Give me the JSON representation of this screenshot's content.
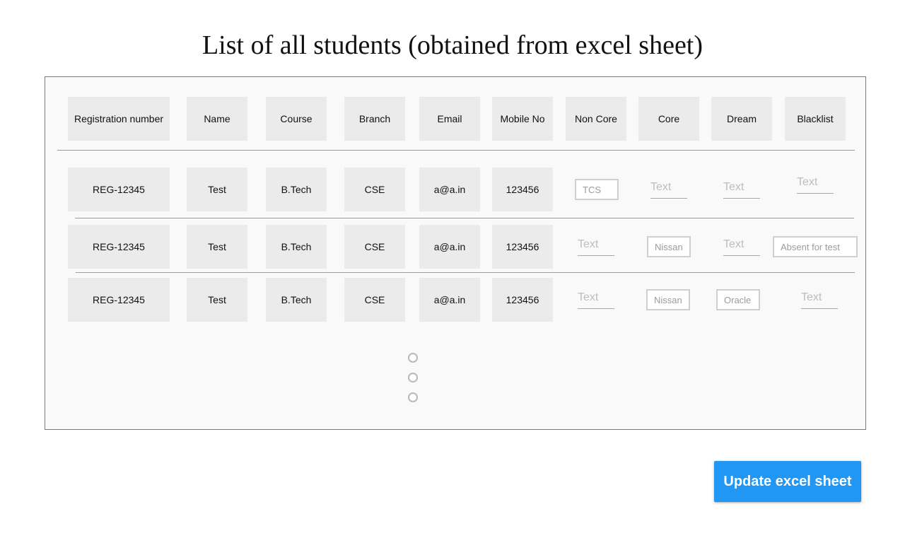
{
  "page_title": "List of all students (obtained from excel sheet)",
  "headers": {
    "registration": "Registration number",
    "name": "Name",
    "course": "Course",
    "branch": "Branch",
    "email": "Email",
    "mobile": "Mobile No",
    "non_core": "Non Core",
    "core": "Core",
    "dream": "Dream",
    "blacklist": "Blacklist"
  },
  "rows": [
    {
      "registration": "REG-12345",
      "name": "Test",
      "course": "B.Tech",
      "branch": "CSE",
      "email": "a@a.in",
      "mobile": "123456",
      "non_core": "TCS",
      "core": "",
      "dream": "",
      "blacklist": ""
    },
    {
      "registration": "REG-12345",
      "name": "Test",
      "course": "B.Tech",
      "branch": "CSE",
      "email": "a@a.in",
      "mobile": "123456",
      "non_core": "",
      "core": "Nissan",
      "dream": "",
      "blacklist": "Absent for test"
    },
    {
      "registration": "REG-12345",
      "name": "Test",
      "course": "B.Tech",
      "branch": "CSE",
      "email": "a@a.in",
      "mobile": "123456",
      "non_core": "",
      "core": "Nissan",
      "dream": "Oracle",
      "blacklist": ""
    }
  ],
  "input_placeholder": "Text",
  "pagination_dots": 3,
  "update_button_label": "Update excel sheet",
  "colors": {
    "button": "#2196f3",
    "cell_background": "#ebebeb",
    "panel_background": "#f9f9f9"
  }
}
